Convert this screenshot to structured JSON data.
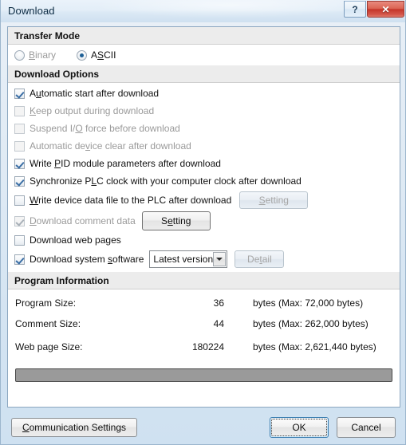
{
  "window": {
    "title": "Download",
    "help_icon": "?",
    "close_icon": "✕"
  },
  "transfer_mode": {
    "header": "Transfer Mode",
    "options": [
      {
        "label_pre": "B",
        "label_key": "B",
        "label": "Binary",
        "pre": "",
        "key": "B",
        "post": "inary",
        "selected": false
      },
      {
        "label": "ASCII",
        "pre": "A",
        "key": "S",
        "post": "CII",
        "selected": true
      }
    ]
  },
  "download_options": {
    "header": "Download Options",
    "items": [
      {
        "pre": "A",
        "key": "u",
        "post": "tomatic start after download",
        "checked": true,
        "enabled": true,
        "underline": true
      },
      {
        "pre": "",
        "key": "K",
        "post": "eep output during download",
        "checked": false,
        "enabled": false,
        "underline": true
      },
      {
        "pre": "Suspend I/",
        "key": "O",
        "post": " force before download",
        "checked": false,
        "enabled": false,
        "underline": true
      },
      {
        "pre": "Automatic de",
        "key": "v",
        "post": "ice clear after download",
        "checked": false,
        "enabled": false,
        "underline": true
      },
      {
        "pre": "Write ",
        "key": "P",
        "post": "ID module parameters after download",
        "checked": true,
        "enabled": true,
        "underline": true
      },
      {
        "pre": "Synchronize P",
        "key": "L",
        "post": "C clock with your computer clock after download",
        "checked": true,
        "enabled": true,
        "underline": true
      },
      {
        "pre": "",
        "key": "W",
        "post": "rite device data file to the PLC after download",
        "checked": false,
        "enabled": true,
        "underline": true
      },
      {
        "pre": "",
        "key": "D",
        "post": "ownload comment data",
        "checked": true,
        "enabled": false,
        "underline": true
      },
      {
        "pre": "Download web pages",
        "key": "",
        "post": "",
        "checked": false,
        "enabled": true,
        "underline": false
      },
      {
        "pre": "Download system ",
        "key": "s",
        "post": "oftware",
        "checked": true,
        "enabled": true,
        "underline": true
      }
    ],
    "setting_button_disabled": {
      "pre": "",
      "key": "S",
      "post": "etting",
      "label": "Setting"
    },
    "setting_button_enabled": {
      "pre": "S",
      "key": "e",
      "post": "tting",
      "label": "Setting"
    },
    "system_software_combo": {
      "value": "Latest version",
      "arrow_icon": "chevron-down-icon"
    },
    "detail_button": {
      "pre": "De",
      "key": "t",
      "post": "ail",
      "label": "Detail"
    }
  },
  "program_information": {
    "header": "Program Information",
    "rows": [
      {
        "label": "Program Size:",
        "value": "36",
        "unit": "bytes (Max: 72,000 bytes)"
      },
      {
        "label": "Comment Size:",
        "value": "44",
        "unit": "bytes (Max: 262,000 bytes)"
      },
      {
        "label": "Web page Size:",
        "value": "180224",
        "unit": "bytes (Max: 2,621,440 bytes)"
      }
    ]
  },
  "progress": {
    "name": "download-progress-bar",
    "percent": 100
  },
  "footer": {
    "communication_settings": {
      "pre": "",
      "key": "C",
      "post": "ommunication Settings",
      "label": "Communication Settings"
    },
    "ok": "OK",
    "cancel": "Cancel"
  },
  "colors": {
    "accent": "#3c7fb1",
    "close_button": "#c5362a",
    "section_header_bg": "#ececec",
    "progress_fill": "#9a9a9a",
    "disabled_text": "#9a9a9a"
  }
}
